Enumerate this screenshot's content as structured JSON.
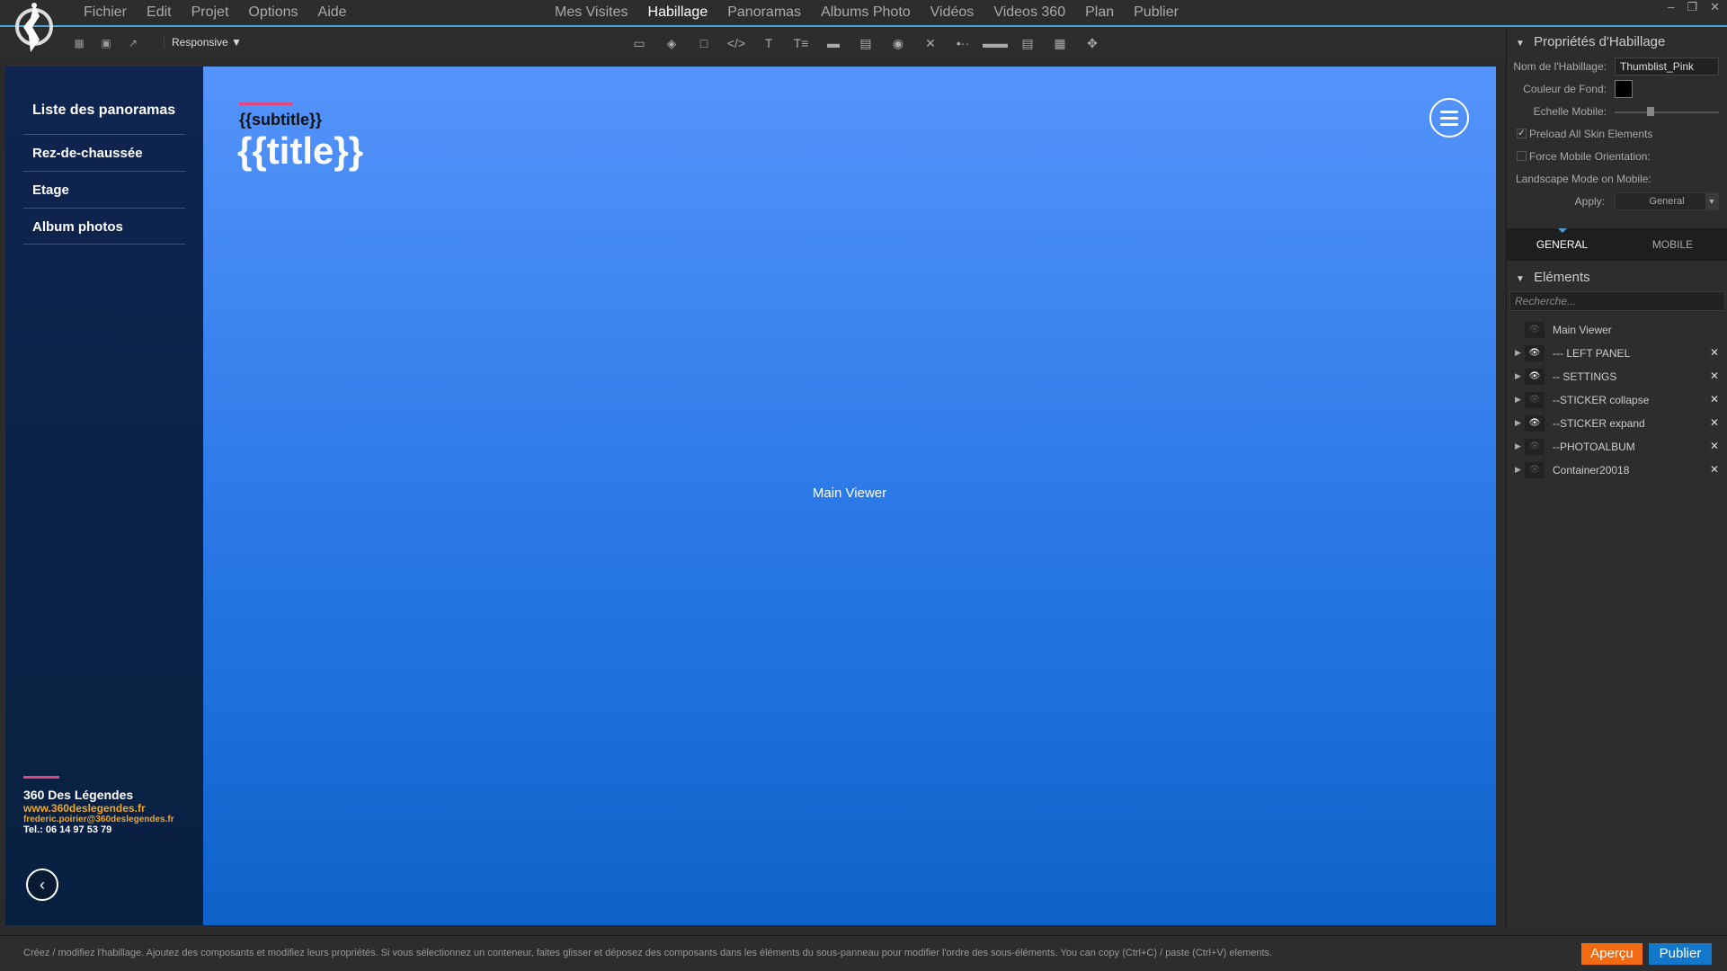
{
  "menubar": {
    "left": [
      "Fichier",
      "Edit",
      "Projet",
      "Options",
      "Aide"
    ],
    "center": [
      "Mes Visites",
      "Habillage",
      "Panoramas",
      "Albums Photo",
      "Vidéos",
      "Videos 360",
      "Plan",
      "Publier"
    ],
    "active": "Habillage"
  },
  "toolbar": {
    "responsive_label": "Responsive"
  },
  "left_panel": {
    "title": "Liste des panoramas",
    "items": [
      "Rez-de-chaussée",
      "Etage",
      "Album photos"
    ],
    "company": "360 Des Légendes",
    "website": "www.360deslegendes.fr",
    "email": "frederic.poirier@360deslegendes.fr",
    "tel": "Tel.: 06 14 97 53 79"
  },
  "viewer": {
    "subtitle": "{{subtitle}}",
    "title": "{{title}}",
    "center_label": "Main Viewer"
  },
  "properties": {
    "header": "Propriétés d'Habillage",
    "name_label": "Nom de l'Habillage:",
    "name_value": "Thumblist_Pink",
    "bg_label": "Couleur de Fond:",
    "scale_label": "Echelle Mobile:",
    "preload_label": "Preload All Skin Elements",
    "force_label": "Force Mobile Orientation:",
    "landscape_label": "Landscape Mode on Mobile:",
    "apply_label": "Apply:",
    "apply_value": "General",
    "bg_color": "#000000",
    "scale_value": 0.25
  },
  "tabs": {
    "general": "GENERAL",
    "mobile": "MOBILE"
  },
  "elements": {
    "header": "Eléments",
    "search_placeholder": "Recherche...",
    "rows": [
      {
        "name": "Main Viewer",
        "visible": false,
        "expandable": false,
        "deletable": false
      },
      {
        "name": "--- LEFT PANEL",
        "visible": true,
        "expandable": true,
        "deletable": true
      },
      {
        "name": "-- SETTINGS",
        "visible": true,
        "expandable": true,
        "deletable": true
      },
      {
        "name": "--STICKER collapse",
        "visible": false,
        "expandable": true,
        "deletable": true
      },
      {
        "name": "--STICKER expand",
        "visible": true,
        "expandable": true,
        "deletable": true
      },
      {
        "name": "--PHOTOALBUM",
        "visible": false,
        "expandable": true,
        "deletable": true
      },
      {
        "name": "Container20018",
        "visible": false,
        "expandable": true,
        "deletable": true
      }
    ]
  },
  "statusbar": {
    "text": "Créez / modifiez l'habillage. Ajoutez des composants et modifiez leurs propriétés. Si vous sélectionnez un conteneur, faites glisser et déposez des composants dans les éléments du sous-panneau pour modifier l'ordre des sous-éléments. You can copy (Ctrl+C) / paste (Ctrl+V) elements.",
    "apercu": "Aperçu",
    "publier": "Publier"
  },
  "colors": {
    "accent": "#4a9fd6",
    "pink": "#e0467f",
    "orange": "#f5a623",
    "apercu_bg": "#f26a12",
    "publier_bg": "#1378c9"
  }
}
